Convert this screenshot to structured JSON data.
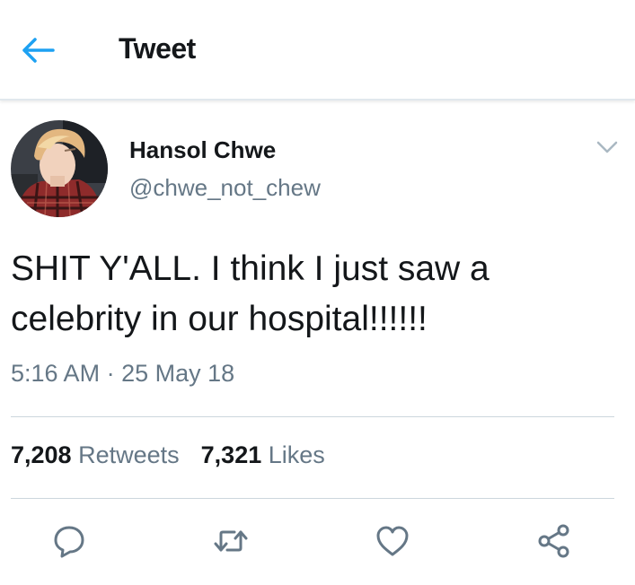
{
  "header": {
    "title": "Tweet",
    "back_icon": "arrow-left-icon",
    "accent_color": "#1da1f2"
  },
  "tweet": {
    "author": {
      "name": "Hansol Chwe",
      "handle": "@chwe_not_chew",
      "avatar": "profile-photo"
    },
    "text_line1": "SHIT Y'ALL. I think I just saw a",
    "text_line2": "celebrity in our hospital!!!!!!",
    "time": "5:16 AM",
    "separator": "·",
    "date": "25 May 18",
    "retweets_count": "7,208",
    "retweets_label": "Retweets",
    "likes_count": "7,321",
    "likes_label": "Likes"
  },
  "actions": [
    {
      "name": "reply",
      "icon": "speech-bubble-icon"
    },
    {
      "name": "retweet",
      "icon": "retweet-icon"
    },
    {
      "name": "like",
      "icon": "heart-icon"
    },
    {
      "name": "share",
      "icon": "share-icon"
    }
  ],
  "colors": {
    "text_primary": "#14171a",
    "text_secondary": "#657786",
    "divider": "#ccd6dd",
    "icon": "#657786"
  }
}
